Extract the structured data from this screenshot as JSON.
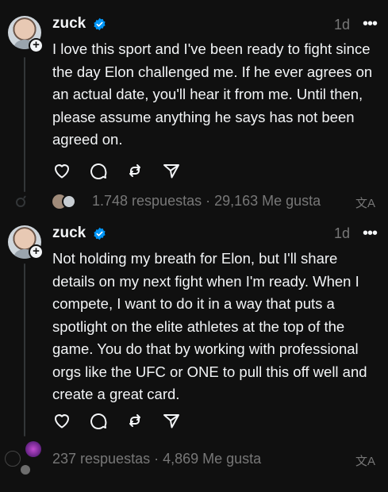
{
  "posts": [
    {
      "username": "zuck",
      "time": "1d",
      "text": "I love this sport and I've been ready to fight since the day Elon challenged me. If he ever agrees on an actual date, you'll hear it from me. Until then, please assume anything he says has not been agreed on.",
      "stats": "1.748 respuestas · 29,163 Me gusta"
    },
    {
      "username": "zuck",
      "time": "1d",
      "text": "Not holding my breath for Elon, but I'll share details on my next fight when I'm ready. When I compete, I want to do it in a way that puts a spotlight on the elite athletes at the top of the game. You do that by working with professional orgs like the UFC or ONE to pull this off well and create a great card.",
      "stats": "237 respuestas · 4,869 Me gusta"
    }
  ],
  "icons": {
    "more": "more-icon",
    "like": "heart-icon",
    "reply": "comment-icon",
    "repost": "repost-icon",
    "share": "send-icon",
    "translate": "translate-icon",
    "verified": "verified-badge-icon"
  },
  "colors": {
    "background": "#101010",
    "text": "#f3f5f7",
    "muted": "#777777",
    "verified": "#0095f6"
  }
}
